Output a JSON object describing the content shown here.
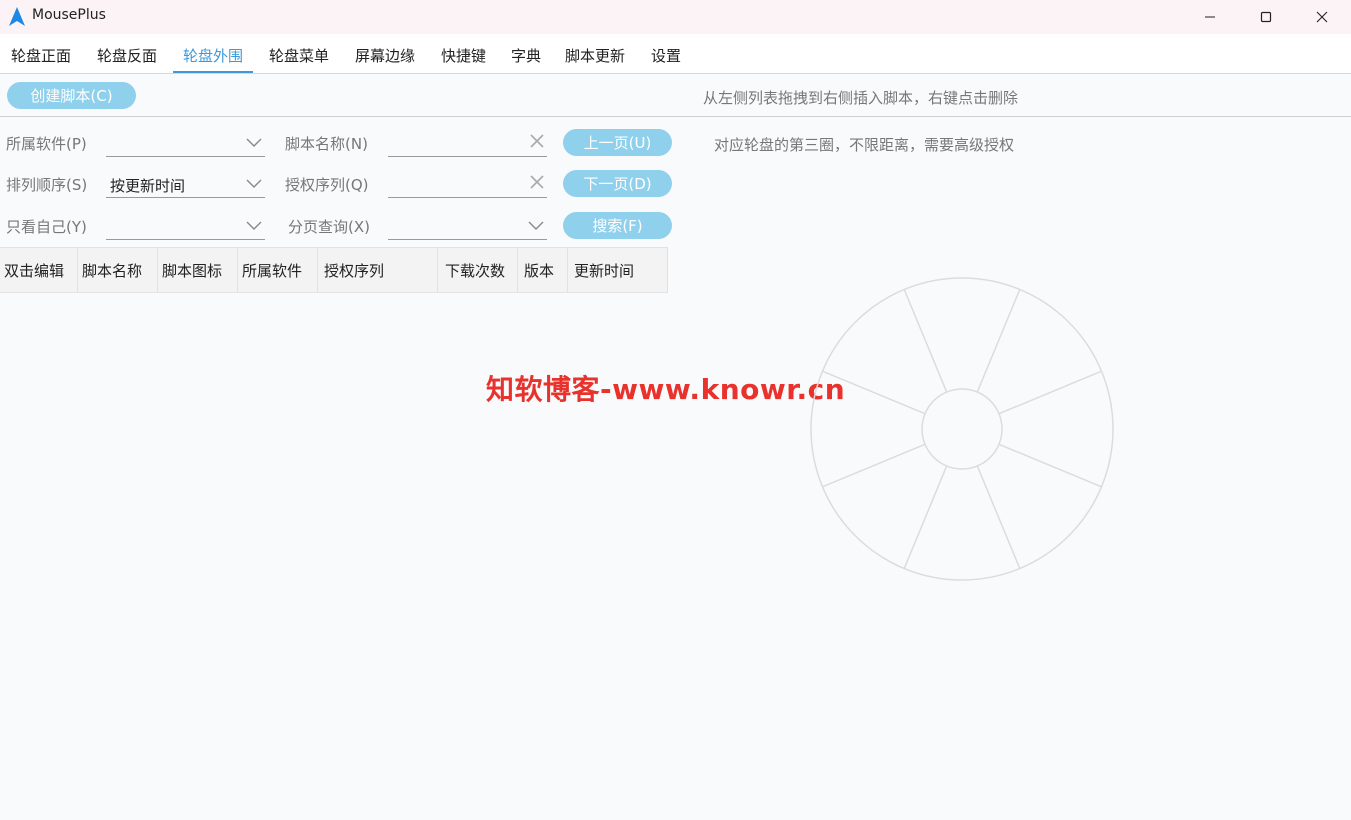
{
  "window": {
    "title": "MousePlus",
    "minimize": "minimize-icon",
    "maximize": "maximize-icon",
    "close": "close-icon"
  },
  "tabs": [
    {
      "label": "轮盘正面"
    },
    {
      "label": "轮盘反面"
    },
    {
      "label": "轮盘外围",
      "active": true
    },
    {
      "label": "轮盘菜单"
    },
    {
      "label": "屏幕边缘"
    },
    {
      "label": "快捷键"
    },
    {
      "label": "字典"
    },
    {
      "label": "脚本更新"
    },
    {
      "label": "设置"
    }
  ],
  "toolbar": {
    "create_script": "创建脚本(C)",
    "drag_hint": "从左侧列表拖拽到右侧插入脚本，右键点击删除"
  },
  "filters": {
    "software_label": "所属软件(P)",
    "software_value": "",
    "script_name_label": "脚本名称(N)",
    "script_name_value": "",
    "sort_label": "排列顺序(S)",
    "sort_value": "按更新时间",
    "license_label": "授权序列(Q)",
    "license_value": "",
    "only_mine_label": "只看自己(Y)",
    "only_mine_value": "",
    "paging_label": "分页查询(X)",
    "paging_value": ""
  },
  "buttons": {
    "prev": "上一页(U)",
    "next": "下一页(D)",
    "search": "搜索(F)"
  },
  "ring_hint": "对应轮盘的第三圈，不限距离，需要高级授权",
  "table": {
    "columns": [
      "双击编辑",
      "脚本名称",
      "脚本图标",
      "所属软件",
      "授权序列",
      "下载次数",
      "版本",
      "更新时间"
    ],
    "rows": []
  },
  "watermark": "知软博客-www.knowr.cn",
  "wheel": {
    "segments": 8
  },
  "colors": {
    "accent": "#3c9ad8",
    "button": "#8fd0ec",
    "watermark": "#e8322b"
  }
}
